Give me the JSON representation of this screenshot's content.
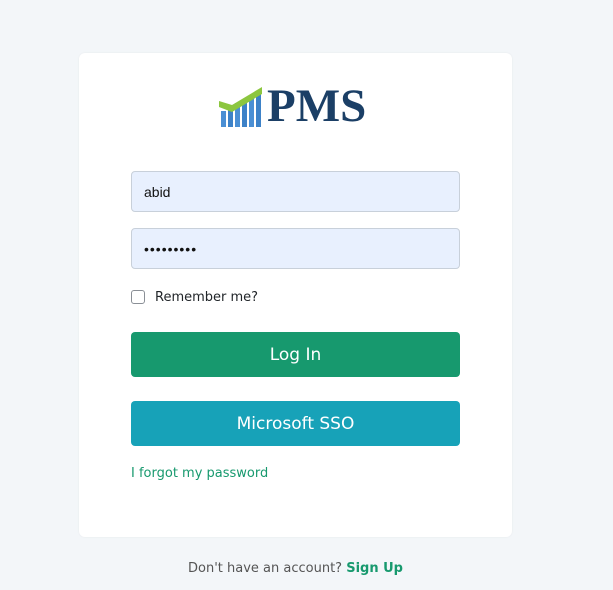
{
  "brand": {
    "logo_text": "PMS",
    "logo_colors": {
      "text": "#1b3f66",
      "bars": "#4a8fd4",
      "check": "#8cc63f"
    }
  },
  "login_form": {
    "username_value": "abid",
    "password_value": "•••••••••",
    "remember_label": "Remember me?",
    "remember_checked": false,
    "login_button": "Log In",
    "sso_button": "Microsoft SSO",
    "forgot_link": "I forgot my password"
  },
  "footer": {
    "prompt": "Don't have an account?",
    "signup_link": "Sign Up"
  },
  "colors": {
    "login_button": "#17996e",
    "sso_button": "#17a2b8",
    "link": "#17996e",
    "page_background": "#f3f6f9"
  }
}
